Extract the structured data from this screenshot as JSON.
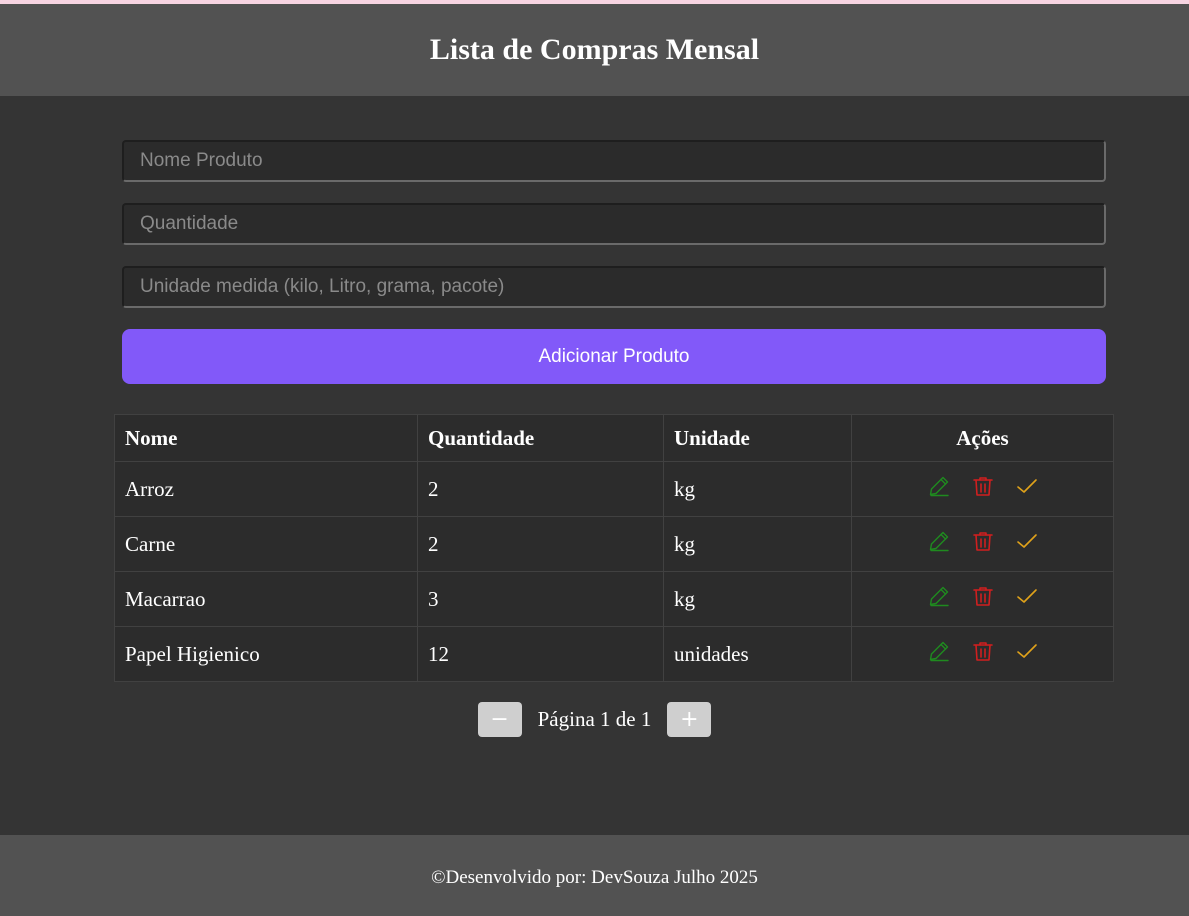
{
  "header": {
    "title": "Lista de Compras Mensal"
  },
  "form": {
    "name_placeholder": "Nome Produto",
    "quantity_placeholder": "Quantidade",
    "unit_placeholder": "Unidade medida (kilo, Litro, grama, pacote)",
    "add_label": "Adicionar Produto"
  },
  "table": {
    "headers": [
      "Nome",
      "Quantidade",
      "Unidade",
      "Ações"
    ],
    "rows": [
      {
        "name": "Arroz",
        "quantity": "2",
        "unit": "kg"
      },
      {
        "name": "Carne",
        "quantity": "2",
        "unit": "kg"
      },
      {
        "name": "Macarrao",
        "quantity": "3",
        "unit": "kg"
      },
      {
        "name": "Papel Higienico",
        "quantity": "12",
        "unit": "unidades"
      }
    ],
    "action_icons": [
      "pencil-edit-icon",
      "trash-icon",
      "check-icon"
    ]
  },
  "pagination": {
    "prev_symbol": "−",
    "next_symbol": "+",
    "label": "Página 1 de 1"
  },
  "footer": {
    "text": "©Desenvolvido por: DevSouza Julho 2025"
  },
  "colors": {
    "accent": "#8259f9",
    "edit": "#1f8a1f",
    "delete": "#d11f1f",
    "done": "#e0a21a"
  }
}
